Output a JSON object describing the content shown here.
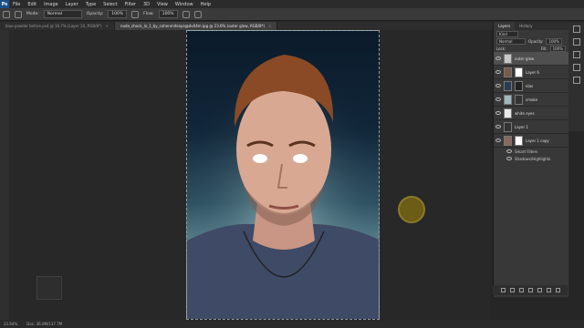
{
  "menubar": {
    "app_icon": "Ps",
    "items": [
      "File",
      "Edit",
      "Image",
      "Layer",
      "Type",
      "Select",
      "Filter",
      "3D",
      "View",
      "Window",
      "Help"
    ]
  },
  "options": {
    "mode_label": "Mode:",
    "mode_value": "Normal",
    "opacity_label": "Opacity:",
    "opacity_value": "100%",
    "flow_label": "Flow:",
    "flow_value": "100%"
  },
  "tabs": [
    {
      "label": "blue powder before.psd @ 16.7% (Layer 10, RGB/8*)"
    },
    {
      "label": "nude_shock_lo_1_by_cohenmitsaya@dv04m.ipg @ 23.6% (outer glow, RGB/8*)"
    }
  ],
  "layers_panel": {
    "tabs": [
      "Layers",
      "History"
    ],
    "kind_label": "Kind",
    "blend_value": "Normal",
    "opacity_label": "Opacity:",
    "opacity_value": "100%",
    "lock_label": "Lock:",
    "fill_label": "Fill:",
    "fill_value": "100%",
    "layers": [
      {
        "name": "outer glow"
      },
      {
        "name": "Layer 6"
      },
      {
        "name": "elas"
      },
      {
        "name": "smoke"
      },
      {
        "name": "white eyes"
      },
      {
        "name": "Layer 1"
      },
      {
        "name": "Layer 1 copy"
      }
    ],
    "smart_filters_label": "Smart Filters",
    "filter_name": "Shadows/Highlights"
  },
  "status": {
    "zoom": "23.64%",
    "doc": "Doc: 36.0M/137.7M"
  },
  "colors": {
    "background": "#262626",
    "panel": "#383838",
    "accent": "#1b4f8a",
    "brush_cursor": "#6b5c16"
  }
}
